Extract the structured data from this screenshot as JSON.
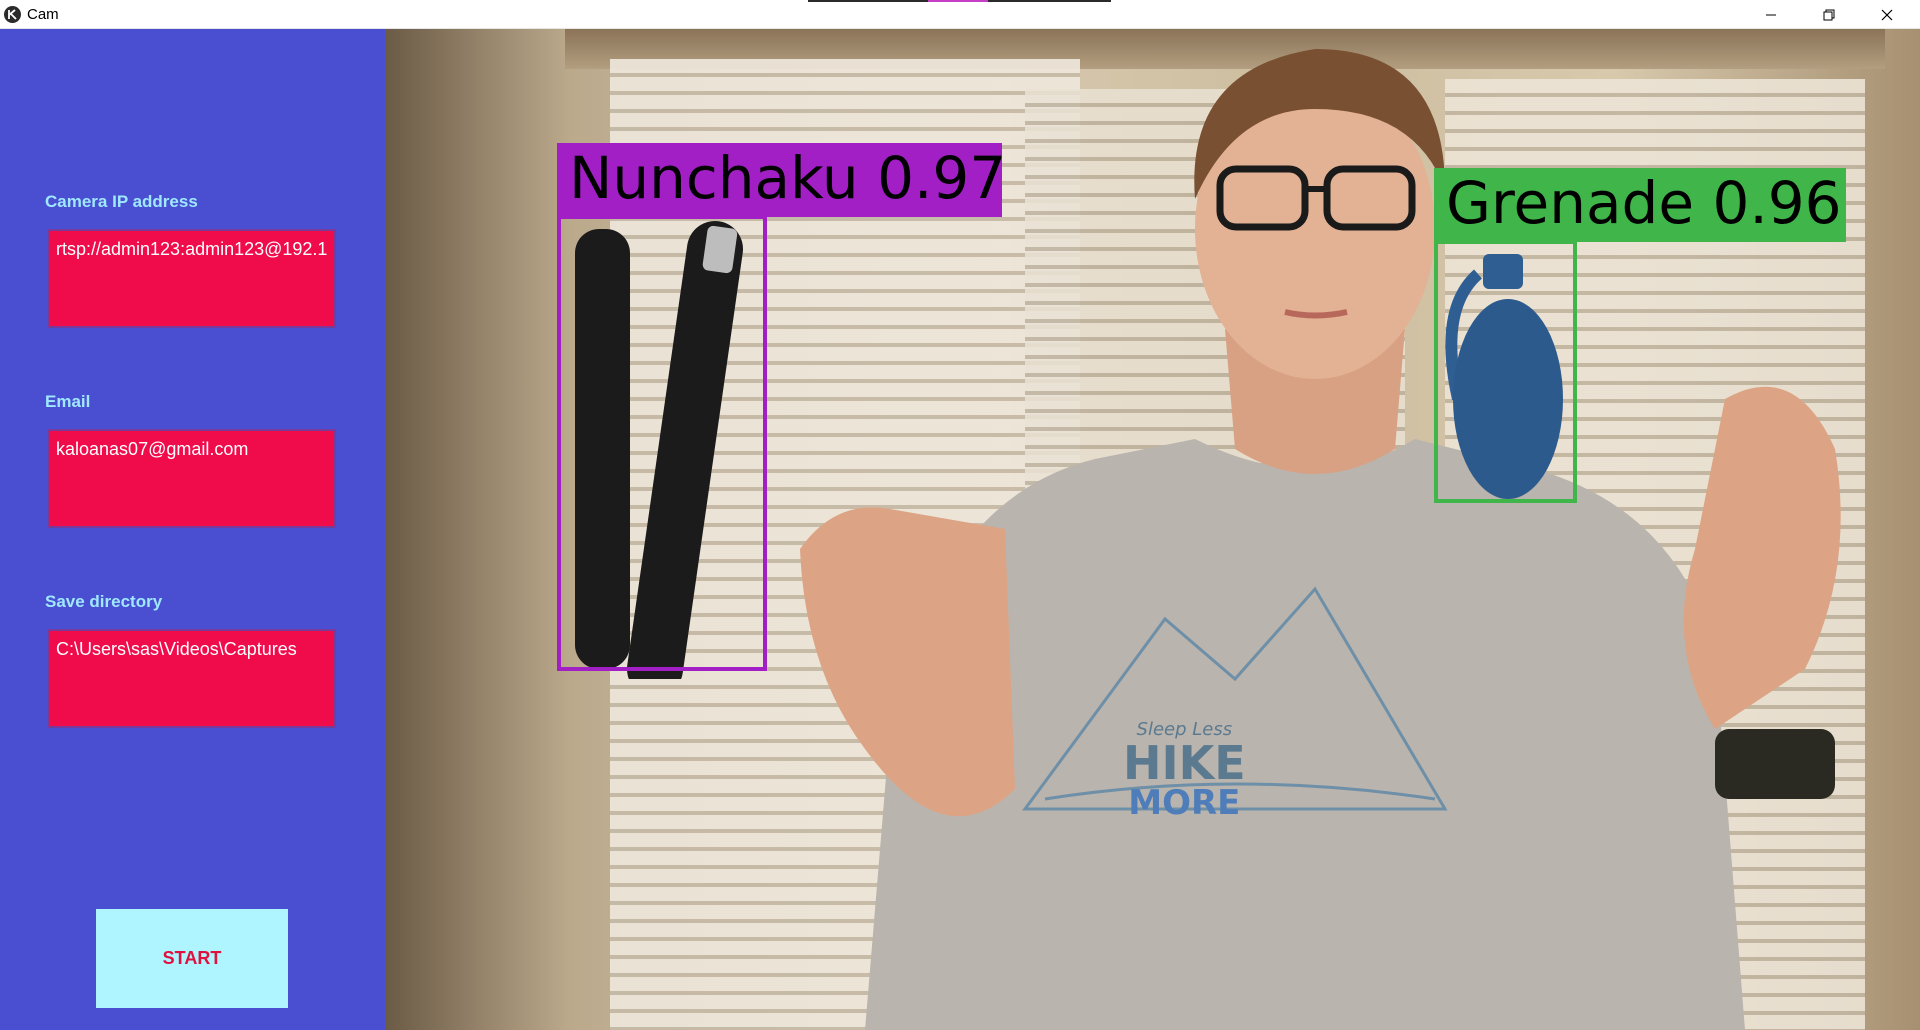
{
  "window": {
    "title": "Cam",
    "controls": {
      "minimize": "minimize-icon",
      "maximize": "restore-icon",
      "close": "close-icon"
    }
  },
  "sidebar": {
    "background": "#4a4ed1",
    "label_color": "#9fe8ff",
    "field_color": "#f00b4b",
    "fields": [
      {
        "label": "Camera IP address",
        "value": "rtsp://admin123:admin123@192.1"
      },
      {
        "label": "Email",
        "value": "kaloanas07@gmail.com"
      },
      {
        "label": "Save directory",
        "value": "C:\\Users\\sas\\Videos\\Captures"
      }
    ],
    "start_label": "START"
  },
  "detections": [
    {
      "label": "Nunchaku 0.97",
      "class": "Nunchaku",
      "confidence": 0.97,
      "color": "#a21fc6"
    },
    {
      "label": "Grenade 0.96",
      "class": "Grenade",
      "confidence": 0.96,
      "color": "#3fb54a"
    }
  ],
  "shirt_text": {
    "line1": "Sleep Less",
    "line2": "HIKE",
    "line3": "MORE"
  }
}
